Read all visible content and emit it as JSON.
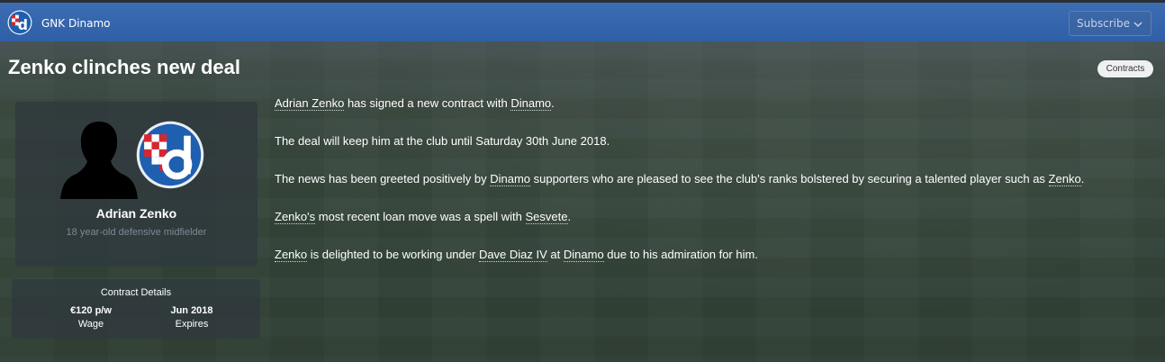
{
  "topbar": {
    "club_name": "GNK Dinamo",
    "subscribe_label": "Subscribe",
    "logo_icon": "dinamo-crest-icon"
  },
  "article": {
    "headline": "Zenko clinches new deal",
    "tag": "Contracts",
    "paragraphs": [
      [
        {
          "t": "Adrian Zenko",
          "link": true
        },
        {
          "t": " has signed a new contract with "
        },
        {
          "t": "Dinamo",
          "link": true
        },
        {
          "t": "."
        }
      ],
      [
        {
          "t": "The deal will keep him at the club until Saturday 30th June 2018."
        }
      ],
      [
        {
          "t": "The news has been greeted positively by "
        },
        {
          "t": "Dinamo",
          "link": true
        },
        {
          "t": " supporters who are pleased to see the club's ranks bolstered by securing a talented player such as "
        },
        {
          "t": "Zenko",
          "link": true
        },
        {
          "t": "."
        }
      ],
      [
        {
          "t": "Zenko's",
          "link": true
        },
        {
          "t": " most recent loan move was a spell with "
        },
        {
          "t": "Sesvete",
          "link": true
        },
        {
          "t": "."
        }
      ],
      [
        {
          "t": "Zenko",
          "link": true
        },
        {
          "t": " is delighted to be working under "
        },
        {
          "t": "Dave Diaz IV",
          "link": true
        },
        {
          "t": " at "
        },
        {
          "t": "Dinamo",
          "link": true
        },
        {
          "t": " due to his admiration for him."
        }
      ]
    ]
  },
  "player": {
    "name": "Adrian Zenko",
    "description": "18 year-old defensive midfielder"
  },
  "contract": {
    "title": "Contract Details",
    "wage_value": "€120 p/w",
    "wage_label": "Wage",
    "expires_value": "Jun 2018",
    "expires_label": "Expires"
  },
  "colors": {
    "topbar": "#3c6db3",
    "card_bg": "#30383e",
    "crest_blue": "#1f5fb0",
    "crest_red": "#d8262e"
  }
}
